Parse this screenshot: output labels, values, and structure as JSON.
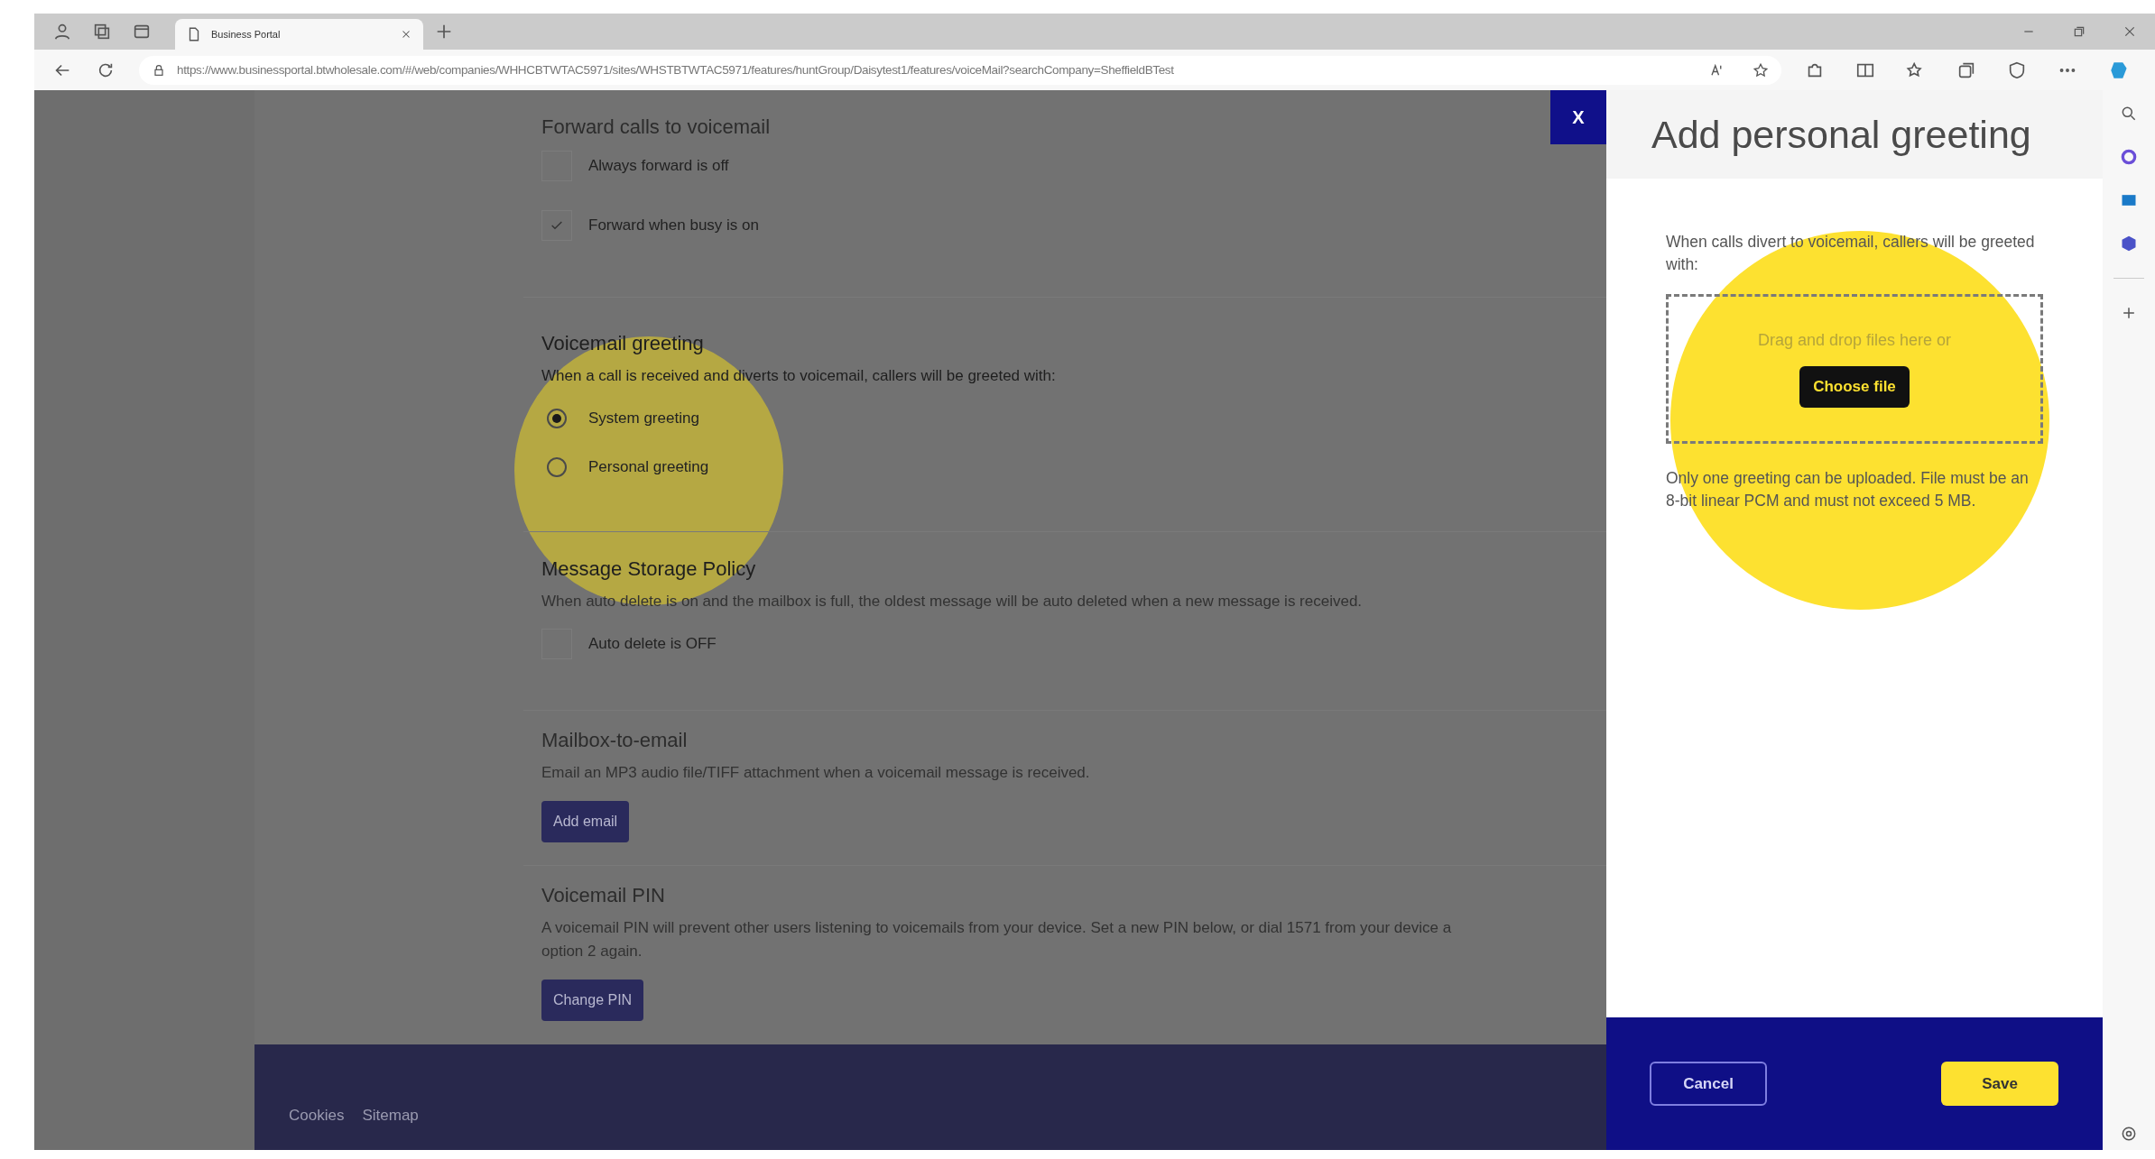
{
  "browser": {
    "tabs": [
      {
        "title": "Business Portal",
        "selected": true
      }
    ],
    "address": "https://www.businessportal.btwholesale.com/#/web/companies/WHHCBTWTAC5971/sites/WHSTBTWTAC5971/features/huntGroup/Daisytest1/features/voiceMail?searchCompany=SheffieldBTest"
  },
  "sections": [
    {
      "kind": "checkboxes",
      "heading": "Forward calls to voicemail",
      "items": [
        {
          "label": "Always forward is off",
          "checked": false
        },
        {
          "label": "Forward when busy is on",
          "checked": true
        }
      ]
    },
    {
      "kind": "radios",
      "heading": "Voicemail greeting",
      "description": [
        "When a call is received and diverts to voicemail, callers will be greeted with:"
      ],
      "items": [
        {
          "label": "System greeting",
          "selected": true
        },
        {
          "label": "Personal greeting",
          "selected": false
        }
      ]
    },
    {
      "kind": "checkboxes",
      "heading": "Message Storage Policy",
      "description": [
        "When auto delete is on and the mailbox is full, the oldest message will be auto deleted when a new message is received."
      ],
      "items": [
        {
          "label": "Auto delete is OFF",
          "checked": false
        }
      ]
    },
    {
      "kind": "button",
      "heading": "Mailbox-to-email",
      "description": [
        "Email an MP3 audio file/TIFF attachment when a voicemail message is received."
      ],
      "button": "Add email"
    },
    {
      "kind": "button",
      "heading": "Voicemail PIN",
      "description": [
        "A voicemail PIN will prevent other users listening to voicemails from your device. Set a new PIN below, or dial 1571 from your device a",
        "option 2 again."
      ],
      "button": "Change PIN"
    }
  ],
  "footer": {
    "links": [
      "Cookies",
      "Sitemap"
    ]
  },
  "panel": {
    "close": "X",
    "title": "Add personal greeting",
    "intro": "When calls divert to voicemail, callers will be greeted with:",
    "dropzone": {
      "prompt": "Drag and drop files here or",
      "button": "Choose file"
    },
    "note": "Only one greeting can be uploaded. File must be an 8-bit linear PCM and must not exceed 5 MB.",
    "buttons": [
      {
        "label": "Cancel",
        "kind": "secondary"
      },
      {
        "label": "Save",
        "kind": "primary"
      }
    ]
  }
}
